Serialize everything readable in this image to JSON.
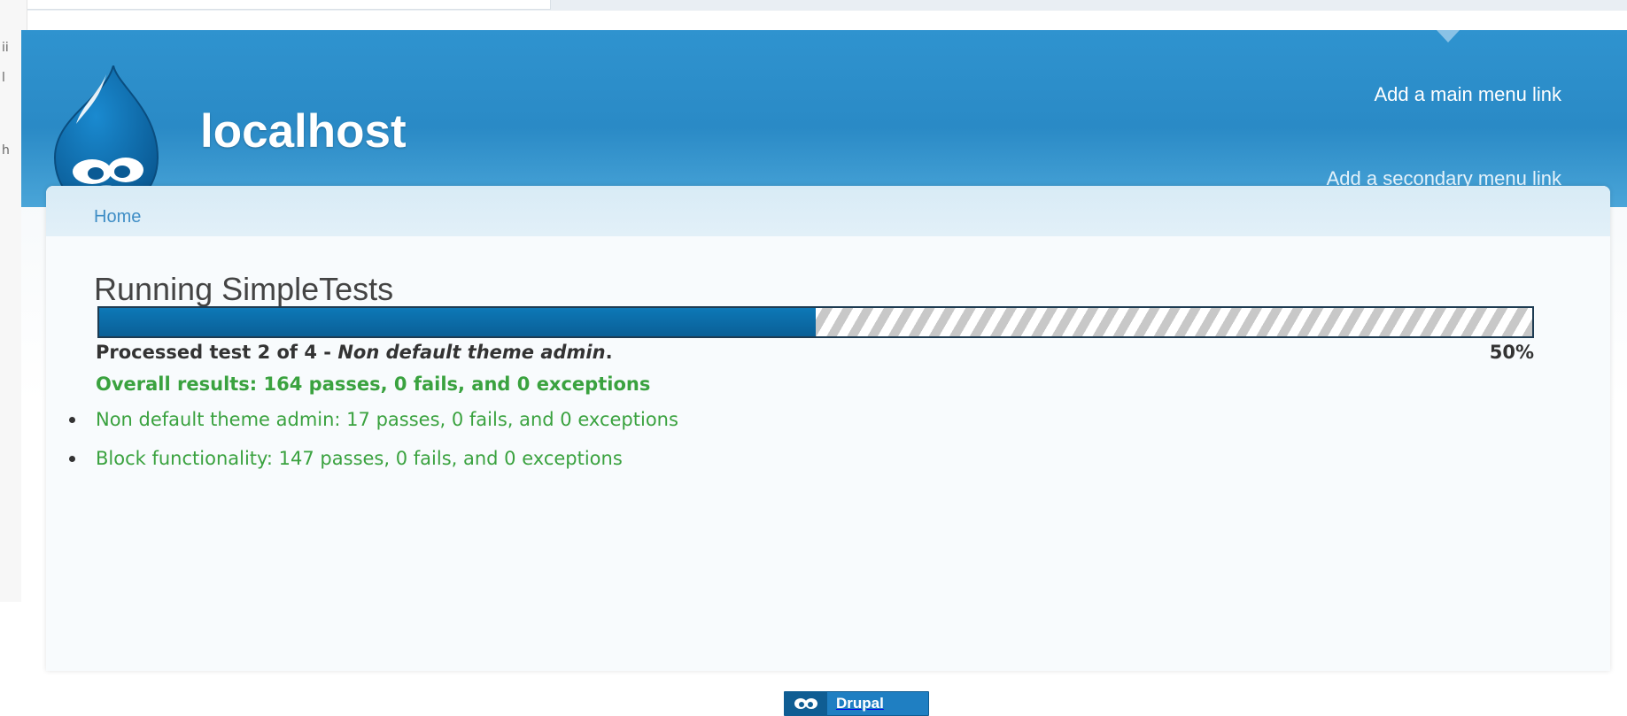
{
  "header": {
    "site_name": "localhost",
    "main_menu_link": "Add a main menu link",
    "secondary_menu_link": "Add a secondary menu link"
  },
  "breadcrumb": "Home",
  "page": {
    "title": "Running SimpleTests"
  },
  "progress": {
    "percent": 50,
    "percent_label": "50%",
    "message_prefix": "Processed test 2 of 4 - ",
    "message_test": "Non default theme admin",
    "message_suffix": "."
  },
  "results": {
    "overall": "Overall results: 164 passes, 0 fails, and 0 exceptions",
    "items": [
      "Non default theme admin: 17 passes, 0 fails, and 0 exceptions",
      "Block functionality: 147 passes, 0 fails, and 0 exceptions"
    ]
  },
  "footer": {
    "powered_by_label": "Drupal"
  },
  "colors": {
    "header_blue": "#2a8ac6",
    "progress_fill": "#0d78b7",
    "success_green": "#3aa23f",
    "breadcrumb_link": "#3f8ec6"
  },
  "icons": {
    "logo": "drupal-drop-logo",
    "powered_badge": "drupal-drop-icon"
  }
}
